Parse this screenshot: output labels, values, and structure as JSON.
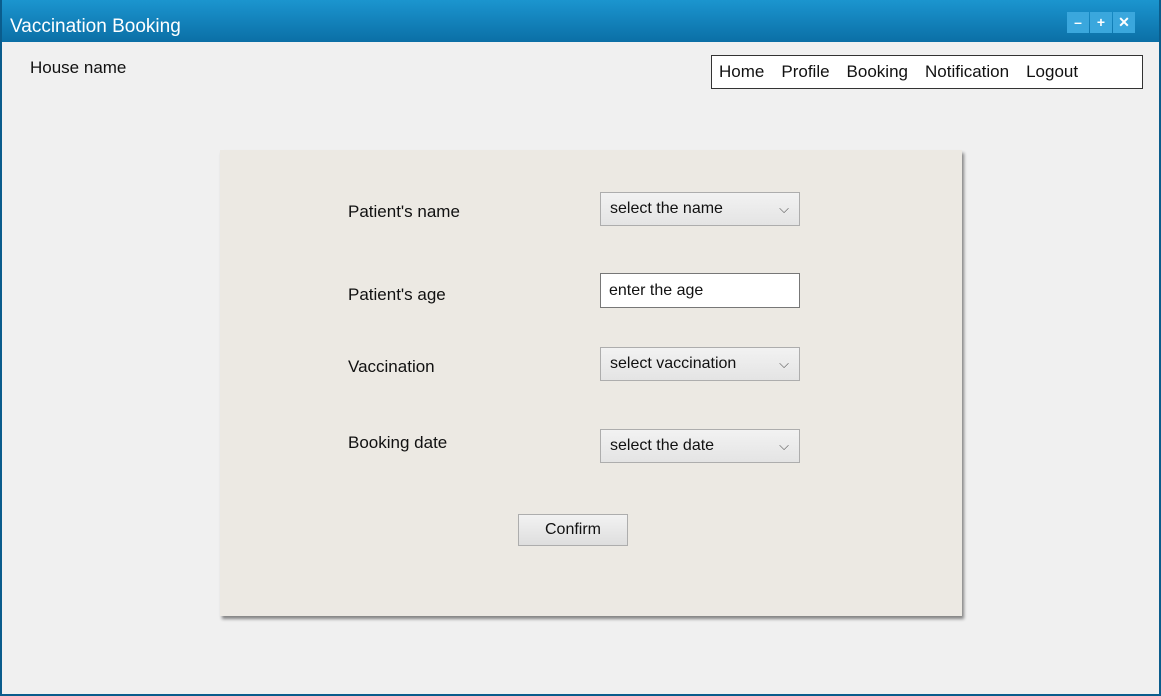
{
  "window": {
    "title": "Vaccination Booking",
    "controls": {
      "minimize": "–",
      "maximize": "+",
      "close": "✕"
    },
    "colors": {
      "titlebar": "#0b6fa6",
      "panel": "#ece9e3",
      "background": "#f0f0f0"
    }
  },
  "header": {
    "house_name": "House name",
    "nav": [
      "Home",
      "Profile",
      "Booking",
      "Notification",
      "Logout"
    ]
  },
  "form": {
    "fields": [
      {
        "label": "Patient's name",
        "type": "select",
        "value": "select the name"
      },
      {
        "label": "Patient's age",
        "type": "input",
        "placeholder": "enter the age"
      },
      {
        "label": "Vaccination",
        "type": "select",
        "value": "select vaccination"
      },
      {
        "label": "Booking date",
        "type": "select",
        "value": "select the date"
      }
    ],
    "chevron": "⌵",
    "confirm_label": "Confirm"
  }
}
